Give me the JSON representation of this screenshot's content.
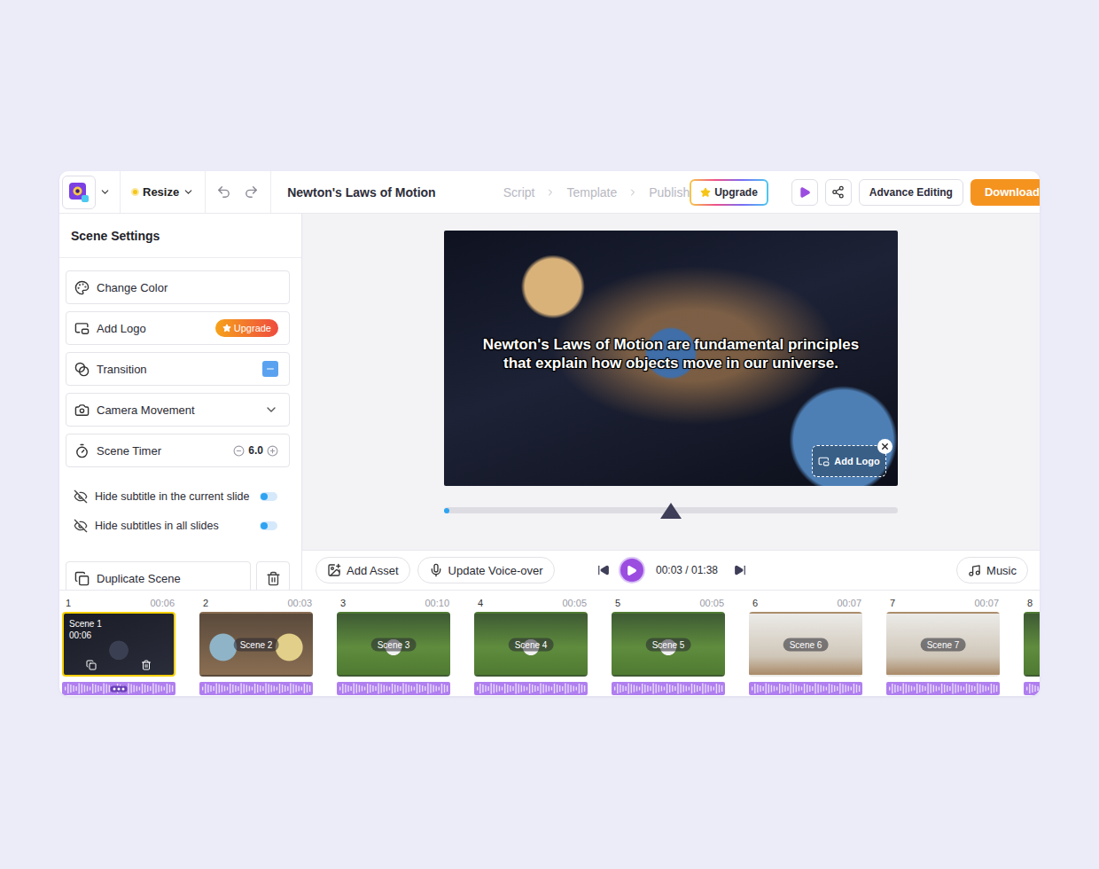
{
  "toolbar": {
    "resize": "Resize",
    "title": "Newton's Laws of Motion",
    "steps": [
      {
        "label": "Script",
        "selected": false
      },
      {
        "label": "Template",
        "selected": false
      },
      {
        "label": "Publish",
        "selected": false
      }
    ],
    "upgrade": "Upgrade",
    "advance_editing": "Advance Editing",
    "download": "Download"
  },
  "sidebar": {
    "title": "Scene Settings",
    "items": [
      {
        "label": "Change Color",
        "kind": "plain"
      },
      {
        "label": "Add Logo",
        "kind": "badge",
        "badge": "Upgrade"
      },
      {
        "label": "Transition",
        "kind": "minus"
      },
      {
        "label": "Camera Movement",
        "kind": "dropdown",
        "expanded": false
      },
      {
        "label": "Scene Timer",
        "kind": "stepper",
        "value": "6.0"
      }
    ],
    "toggles": [
      {
        "label": "Hide subtitle in the current slide",
        "on": false
      },
      {
        "label": "Hide subtitles in all slides",
        "on": false
      }
    ],
    "duplicate": "Duplicate Scene"
  },
  "preview": {
    "subtitle_lines": [
      "Newton's Laws of Motion are fundamental principles",
      "that explain how objects move in our universe."
    ],
    "add_logo": "Add Logo",
    "progress": {
      "level": 0
    }
  },
  "controls": {
    "add_asset": "Add Asset",
    "voice_over": "Update Voice-over",
    "time": "00:03 / 01:38",
    "music": "Music"
  },
  "scenes": [
    {
      "number": "1",
      "duration": "00:06",
      "label": "Scene 1",
      "selected": true,
      "kind": "dark"
    },
    {
      "number": "2",
      "duration": "00:03",
      "label": "Scene 2",
      "selected": false,
      "kind": "sketch"
    },
    {
      "number": "3",
      "duration": "00:10",
      "label": "Scene 3",
      "selected": false,
      "kind": "field"
    },
    {
      "number": "4",
      "duration": "00:05",
      "label": "Scene 4",
      "selected": false,
      "kind": "field"
    },
    {
      "number": "5",
      "duration": "00:05",
      "label": "Scene 5",
      "selected": false,
      "kind": "field"
    },
    {
      "number": "6",
      "duration": "00:07",
      "label": "Scene 6",
      "selected": false,
      "kind": "lab"
    },
    {
      "number": "7",
      "duration": "00:07",
      "label": "Scene 7",
      "selected": false,
      "kind": "lab"
    },
    {
      "number": "8",
      "duration": "",
      "label": "",
      "selected": false,
      "kind": "field"
    }
  ]
}
